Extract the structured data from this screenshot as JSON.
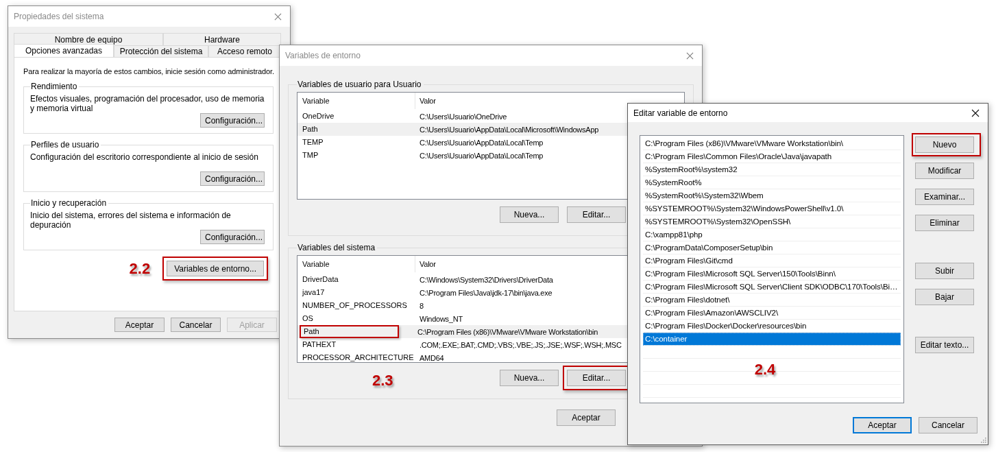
{
  "system_properties": {
    "title": "Propiedades del sistema",
    "tab_rows": [
      {
        "tabs": [
          {
            "label": "Nombre de equipo",
            "selected": false
          },
          {
            "label": "Hardware",
            "selected": false
          }
        ]
      },
      {
        "tabs": [
          {
            "label": "Opciones avanzadas",
            "selected": true
          },
          {
            "label": "Protección del sistema",
            "selected": false
          },
          {
            "label": "Acceso remoto",
            "selected": false
          }
        ]
      }
    ],
    "notice": "Para realizar la mayoría de estos cambios, inicie sesión como administrador.",
    "groups": [
      {
        "title": "Rendimiento",
        "description": "Efectos visuales, programación del procesador, uso de memoria y memoria virtual",
        "button": "Configuración..."
      },
      {
        "title": "Perfiles de usuario",
        "description": "Configuración del escritorio correspondiente al inicio de sesión",
        "button": "Configuración..."
      },
      {
        "title": "Inicio y recuperación",
        "description": "Inicio del sistema, errores del sistema e información de depuración",
        "button": "Configuración..."
      }
    ],
    "annotation": "2.2",
    "env_button": {
      "label": "Variables de entorno...",
      "highlighted": true
    },
    "buttons": [
      {
        "label": "Aceptar",
        "disabled": false
      },
      {
        "label": "Cancelar",
        "disabled": false
      },
      {
        "label": "Aplicar",
        "disabled": true
      }
    ]
  },
  "environment_variables": {
    "title": "Variables de entorno",
    "sections": [
      {
        "title": "Variables de usuario para Usuario",
        "columns": [
          "Variable",
          "Valor"
        ],
        "rows": [
          {
            "variable": "OneDrive",
            "value": "C:\\Users\\Usuario\\OneDrive",
            "selected": false,
            "highlighted": false
          },
          {
            "variable": "Path",
            "value": "C:\\Users\\Usuario\\AppData\\Local\\Microsoft\\WindowsApp",
            "selected": true,
            "highlighted": false
          },
          {
            "variable": "TEMP",
            "value": "C:\\Users\\Usuario\\AppData\\Local\\Temp",
            "selected": false,
            "highlighted": false
          },
          {
            "variable": "TMP",
            "value": "C:\\Users\\Usuario\\AppData\\Local\\Temp",
            "selected": false,
            "highlighted": false
          }
        ],
        "buttons": [
          {
            "label": "Nueva...",
            "highlighted": false
          },
          {
            "label": "Editar...",
            "highlighted": false
          }
        ]
      },
      {
        "title": "Variables del sistema",
        "columns": [
          "Variable",
          "Valor"
        ],
        "rows": [
          {
            "variable": "DriverData",
            "value": "C:\\Windows\\System32\\Drivers\\DriverData",
            "selected": false,
            "highlighted": false
          },
          {
            "variable": "java17",
            "value": "C:\\Program Files\\Java\\jdk-17\\bin\\java.exe",
            "selected": false,
            "highlighted": false
          },
          {
            "variable": "NUMBER_OF_PROCESSORS",
            "value": "8",
            "selected": false,
            "highlighted": false
          },
          {
            "variable": "OS",
            "value": "Windows_NT",
            "selected": false,
            "highlighted": false
          },
          {
            "variable": "Path",
            "value": "C:\\Program Files (x86)\\VMware\\VMware Workstation\\bin",
            "selected": true,
            "highlighted": true
          },
          {
            "variable": "PATHEXT",
            "value": ".COM;.EXE;.BAT;.CMD;.VBS;.VBE;.JS;.JSE;.WSF;.WSH;.MSC",
            "selected": false,
            "highlighted": false
          },
          {
            "variable": "PROCESSOR_ARCHITECTURE",
            "value": "AMD64",
            "selected": false,
            "highlighted": false
          }
        ],
        "annotation": "2.3",
        "buttons": [
          {
            "label": "Nueva...",
            "highlighted": false
          },
          {
            "label": "Editar...",
            "highlighted": true
          }
        ]
      }
    ],
    "buttons": [
      {
        "label": "Aceptar"
      }
    ]
  },
  "edit_variable": {
    "title": "Editar variable de entorno",
    "entries": [
      {
        "text": "C:\\Program Files (x86)\\VMware\\VMware Workstation\\bin\\",
        "selected": false
      },
      {
        "text": "C:\\Program Files\\Common Files\\Oracle\\Java\\javapath",
        "selected": false
      },
      {
        "text": "%SystemRoot%\\system32",
        "selected": false
      },
      {
        "text": "%SystemRoot%",
        "selected": false
      },
      {
        "text": "%SystemRoot%\\System32\\Wbem",
        "selected": false
      },
      {
        "text": "%SYSTEMROOT%\\System32\\WindowsPowerShell\\v1.0\\",
        "selected": false
      },
      {
        "text": "%SYSTEMROOT%\\System32\\OpenSSH\\",
        "selected": false
      },
      {
        "text": "C:\\xampp81\\php",
        "selected": false
      },
      {
        "text": "C:\\ProgramData\\ComposerSetup\\bin",
        "selected": false
      },
      {
        "text": "C:\\Program Files\\Git\\cmd",
        "selected": false
      },
      {
        "text": "C:\\Program Files\\Microsoft SQL Server\\150\\Tools\\Binn\\",
        "selected": false
      },
      {
        "text": "C:\\Program Files\\Microsoft SQL Server\\Client SDK\\ODBC\\170\\Tools\\Bi…",
        "selected": false
      },
      {
        "text": "C:\\Program Files\\dotnet\\",
        "selected": false
      },
      {
        "text": "C:\\Program Files\\Amazon\\AWSCLIV2\\",
        "selected": false
      },
      {
        "text": "C:\\Program Files\\Docker\\Docker\\resources\\bin",
        "selected": false
      },
      {
        "text": "C:\\container",
        "selected": true
      }
    ],
    "annotation": "2.4",
    "button_groups": [
      {
        "buttons": [
          {
            "label": "Nuevo",
            "highlighted": true
          },
          {
            "label": "Modificar",
            "highlighted": false
          },
          {
            "label": "Examinar...",
            "highlighted": false
          },
          {
            "label": "Eliminar",
            "highlighted": false
          }
        ]
      },
      {
        "buttons": [
          {
            "label": "Subir",
            "highlighted": false
          },
          {
            "label": "Bajar",
            "highlighted": false
          }
        ]
      },
      {
        "buttons": [
          {
            "label": "Editar texto...",
            "highlighted": false
          }
        ]
      }
    ],
    "buttons": [
      {
        "label": "Aceptar",
        "default": true
      },
      {
        "label": "Cancelar",
        "default": false
      }
    ]
  }
}
